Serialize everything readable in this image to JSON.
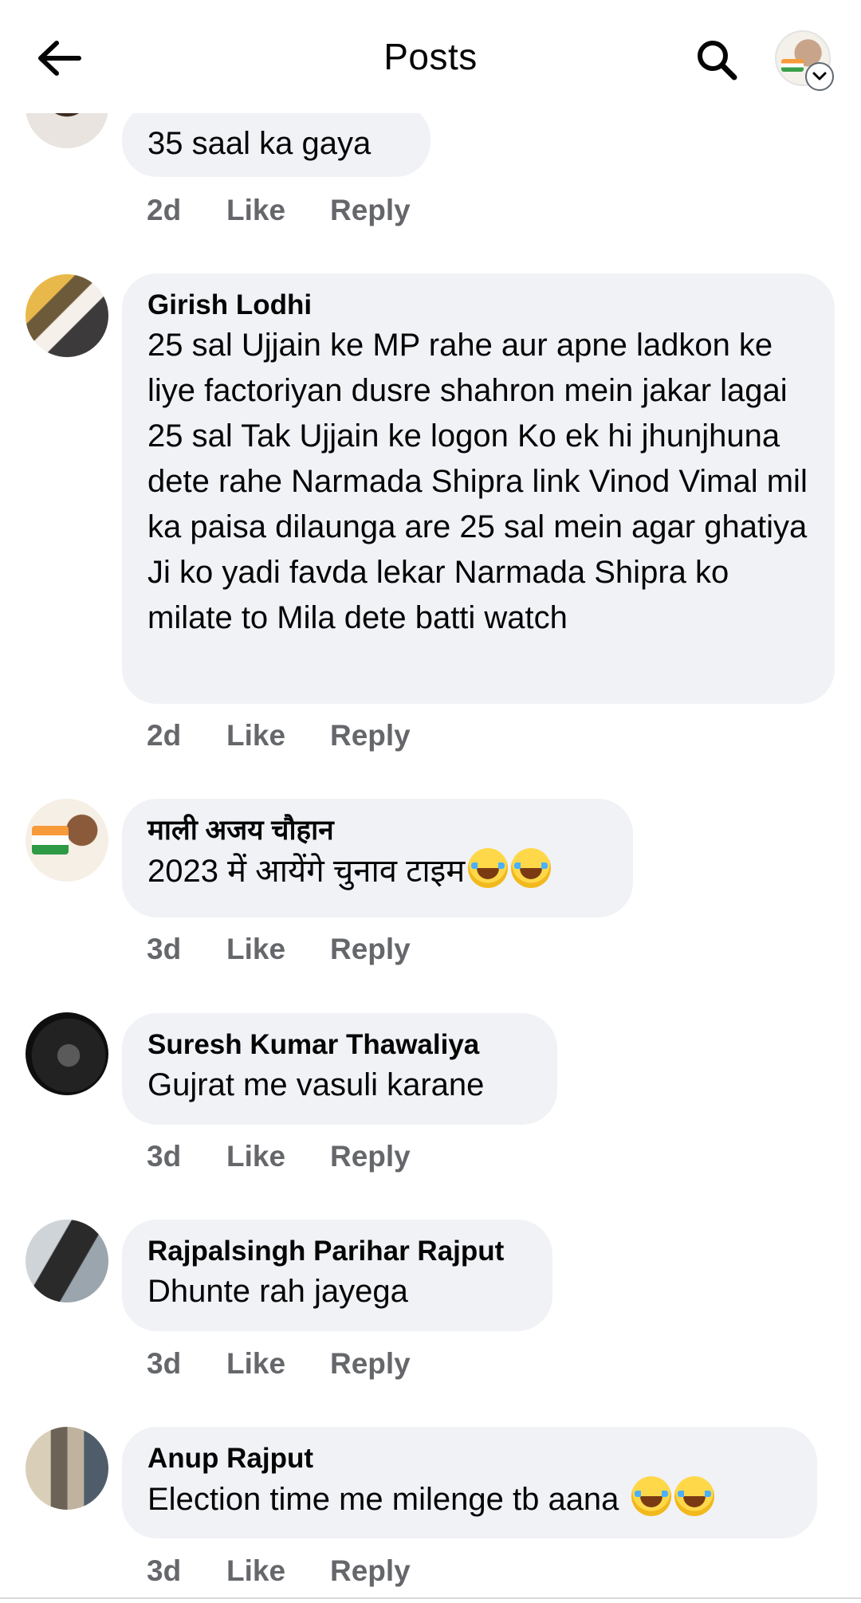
{
  "header": {
    "title": "Posts",
    "back_icon": "arrow-left-icon",
    "search_icon": "search-icon",
    "profile_icon": "avatar",
    "chevron_icon": "chevron-down-icon"
  },
  "comments": [
    {
      "author": "",
      "text": "35 saal ka gaya",
      "time": "2d",
      "like": "Like",
      "reply": "Reply"
    },
    {
      "author": "Girish Lodhi",
      "text": "25 sal Ujjain ke MP rahe aur apne ladkon ke liye factoriyan dusre shahron mein jakar lagai 25 sal Tak Ujjain ke logon Ko ek hi jhunjhuna dete rahe Narmada Shipra link Vinod Vimal mil ka paisa dilaunga are 25 sal mein agar ghatiya Ji ko yadi favda lekar Narmada Shipra ko milate to Mila dete batti watch",
      "time": "2d",
      "like": "Like",
      "reply": "Reply"
    },
    {
      "author": "माली अजय चौहान",
      "text": "2023 में आयेंगे चुनाव टाइम",
      "emoji_count": 2,
      "time": "3d",
      "like": "Like",
      "reply": "Reply"
    },
    {
      "author": "Suresh Kumar Thawaliya",
      "text": "Gujrat me vasuli karane",
      "time": "3d",
      "like": "Like",
      "reply": "Reply"
    },
    {
      "author": "Rajpalsingh Parihar Rajput",
      "text": "Dhunte rah jayega",
      "time": "3d",
      "like": "Like",
      "reply": "Reply"
    },
    {
      "author": "Anup Rajput",
      "text": "Election time me milenge tb aana",
      "emoji_count": 2,
      "time": "3d",
      "like": "Like",
      "reply": "Reply"
    }
  ],
  "colors": {
    "bubble": "#f0f2f5",
    "meta": "#65676b",
    "text": "#050505"
  }
}
